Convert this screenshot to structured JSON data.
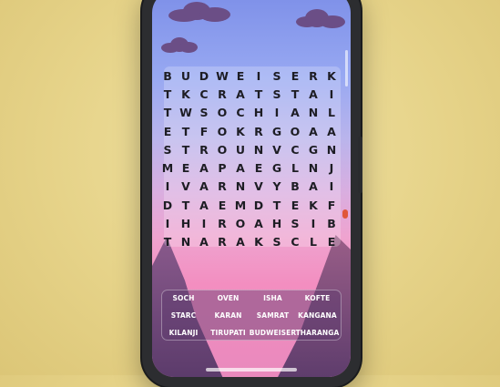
{
  "grid": {
    "rows": [
      [
        "B",
        "U",
        "D",
        "W",
        "E",
        "I",
        "S",
        "E",
        "R",
        "K"
      ],
      [
        "T",
        "K",
        "C",
        "R",
        "A",
        "T",
        "S",
        "T",
        "A",
        "I"
      ],
      [
        "T",
        "W",
        "S",
        "O",
        "C",
        "H",
        "I",
        "A",
        "N",
        "L"
      ],
      [
        "E",
        "T",
        "F",
        "O",
        "K",
        "R",
        "G",
        "O",
        "A",
        "A"
      ],
      [
        "S",
        "T",
        "R",
        "O",
        "U",
        "N",
        "V",
        "C",
        "G",
        "N"
      ],
      [
        "M",
        "E",
        "A",
        "P",
        "A",
        "E",
        "G",
        "L",
        "N",
        "J"
      ],
      [
        "I",
        "V",
        "A",
        "R",
        "N",
        "V",
        "Y",
        "B",
        "A",
        "I"
      ],
      [
        "D",
        "T",
        "A",
        "E",
        "M",
        "D",
        "T",
        "E",
        "K",
        "F"
      ],
      [
        "I",
        "H",
        "I",
        "R",
        "O",
        "A",
        "H",
        "S",
        "I",
        "B"
      ],
      [
        "T",
        "N",
        "A",
        "R",
        "A",
        "K",
        "S",
        "C",
        "L",
        "E"
      ]
    ]
  },
  "words": [
    "SOCH",
    "OVEN",
    "ISHA",
    "KOFTE",
    "STARC",
    "KARAN",
    "SAMRAT",
    "KANGANA",
    "KILANJI",
    "TIRUPATI",
    "BUDWEISER",
    "THARANGA"
  ]
}
